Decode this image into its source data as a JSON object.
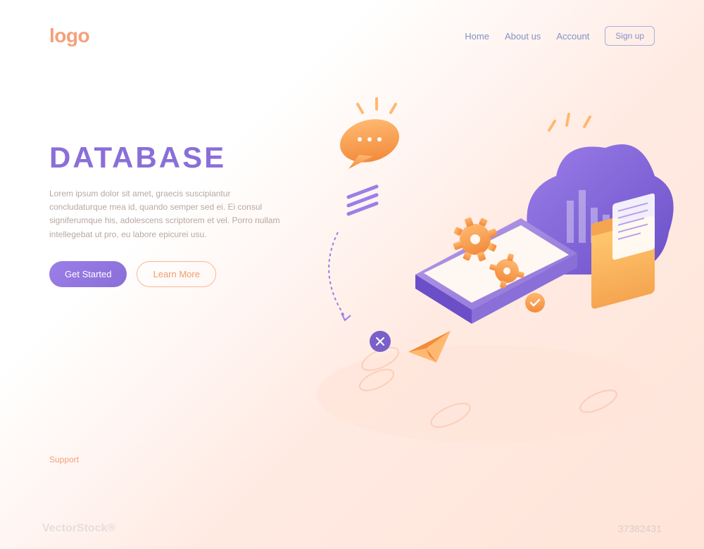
{
  "header": {
    "logo": "logo",
    "nav": {
      "home": "Home",
      "about": "About us",
      "account": "Account",
      "signup": "Sign up"
    }
  },
  "hero": {
    "title": "DATABASE",
    "description": "Lorem ipsum dolor sit amet, graecis suscipiantur concludaturque mea id, quando semper sed ei. Ei consul signiferumque his, adolescens scriptorem et vel. Porro nullam intellegebat ut pro, eu labore epicurei usu.",
    "primary_cta": "Get Started",
    "secondary_cta": "Learn More"
  },
  "footer": {
    "support": "Support"
  },
  "watermark": {
    "brand": "VectorStock®",
    "id": "37382431"
  }
}
